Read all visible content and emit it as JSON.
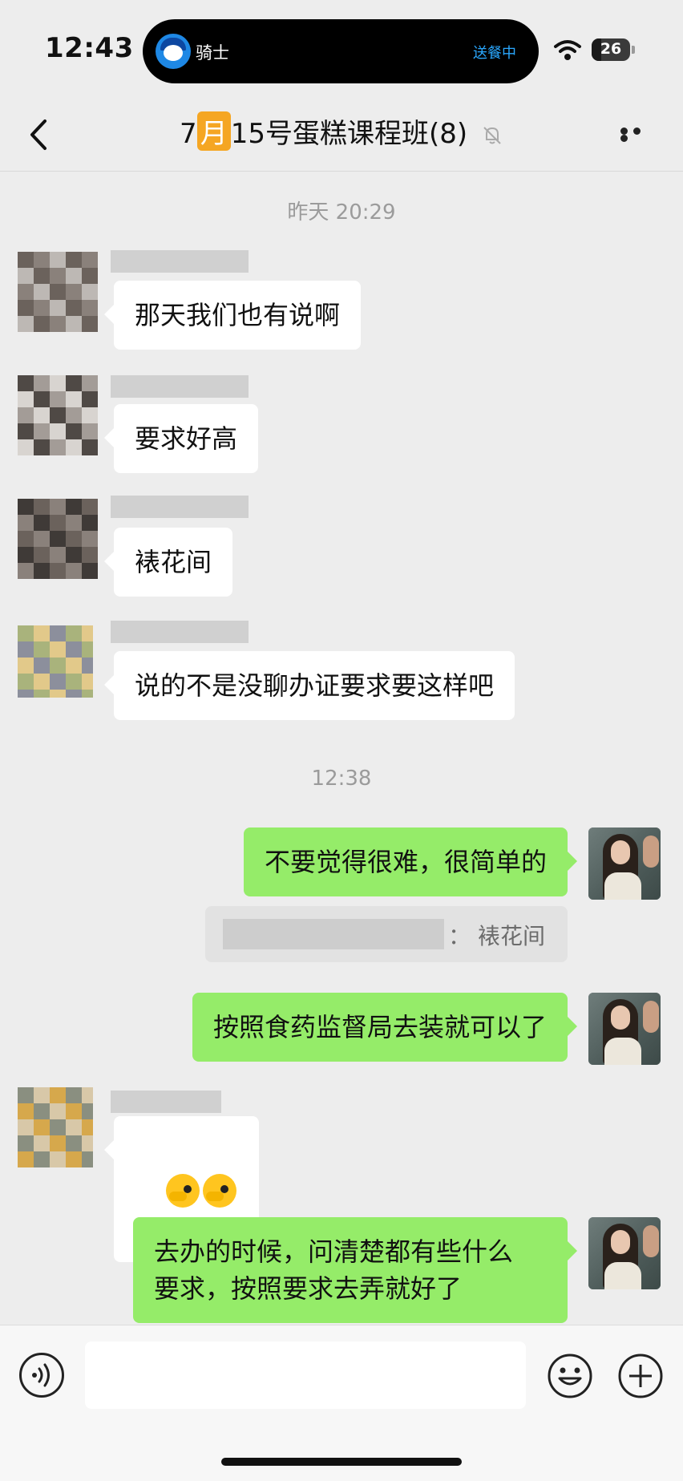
{
  "status_bar": {
    "time": "12:43",
    "activity_title": "骑士",
    "activity_status": "送餐中",
    "battery": "26",
    "battery_level": 0.26
  },
  "nav": {
    "title_prefix": "7",
    "title_badge": "月",
    "title_rest": "15号蛋糕课程班(8)",
    "back_icon": "chevron-left-icon",
    "mute_icon": "bell-off-icon",
    "more_icon": "more-dots-icon"
  },
  "chat": {
    "timestamp_1": "昨天 20:29",
    "timestamp_2": "12:38",
    "messages": [
      {
        "side": "left",
        "text": "那天我们也有说啊"
      },
      {
        "side": "left",
        "text": "要求好高"
      },
      {
        "side": "left",
        "text": "裱花间"
      },
      {
        "side": "left",
        "text": "说的不是没聊办证要求要这样吧"
      },
      {
        "side": "right",
        "text": "不要觉得很难，很简单的"
      },
      {
        "side": "right",
        "text": "按照食药监督局去装就可以了"
      },
      {
        "side": "left",
        "text": ""
      },
      {
        "side": "right",
        "text": "去办的时候，问清楚都有些什么\n要求，按照要求去弄就好了"
      }
    ],
    "quote": {
      "separator": "：",
      "text": "裱花间"
    }
  },
  "input_bar": {
    "voice_icon": "voice-icon",
    "emoji_icon": "smiley-icon",
    "plus_icon": "plus-icon"
  },
  "colors": {
    "background": "#ededed",
    "sent_bubble": "#95ec69",
    "received_bubble": "#ffffff",
    "badge": "#f5a623",
    "activity_status": "#2aa8ff"
  }
}
